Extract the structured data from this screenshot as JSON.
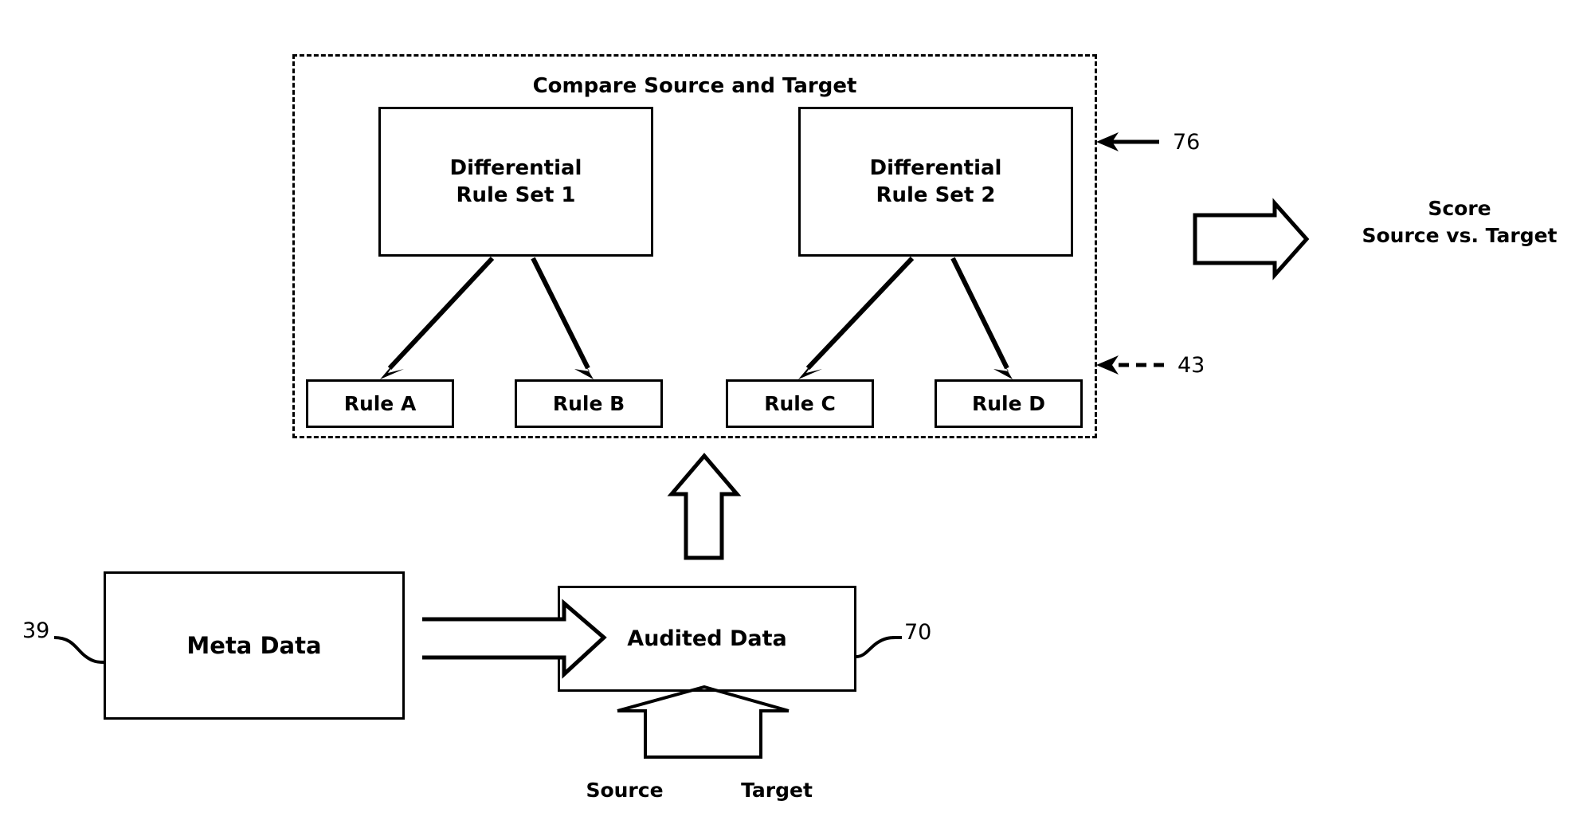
{
  "figure": {
    "type": "patent-flow-diagram",
    "background_color": "#ffffff",
    "line_color": "#000000"
  },
  "compare_region": {
    "title": "Compare Source and Target",
    "border_style": "dashed",
    "reference_numerals": [
      {
        "id": "76",
        "label": "76",
        "points_to": "compare-region-boundary"
      },
      {
        "id": "43",
        "label": "43",
        "points_to": "rule-boxes-boundary"
      }
    ],
    "rule_sets": [
      {
        "id": "rule-set-1",
        "label": "Differential\nRule Set 1"
      },
      {
        "id": "rule-set-2",
        "label": "Differential\nRule Set 2"
      }
    ],
    "rules": [
      {
        "id": "rule-a",
        "label": "Rule A"
      },
      {
        "id": "rule-b",
        "label": "Rule B"
      },
      {
        "id": "rule-c",
        "label": "Rule C"
      },
      {
        "id": "rule-d",
        "label": "Rule D"
      }
    ]
  },
  "output": {
    "score_label": "Score\nSource vs. Target",
    "arrow": "block-arrow-right"
  },
  "data_flow": {
    "meta_data": {
      "label": "Meta Data",
      "reference_numeral": "39"
    },
    "audited_data": {
      "label": "Audited Data",
      "reference_numeral": "70"
    },
    "inputs": [
      {
        "id": "source",
        "label": "Source"
      },
      {
        "id": "target",
        "label": "Target"
      }
    ],
    "arrows": [
      {
        "id": "meta-to-audited",
        "style": "block-arrow-right"
      },
      {
        "id": "audited-to-rules",
        "style": "block-arrow-up"
      },
      {
        "id": "source-target-merge",
        "style": "merge-chevron-up"
      }
    ]
  }
}
